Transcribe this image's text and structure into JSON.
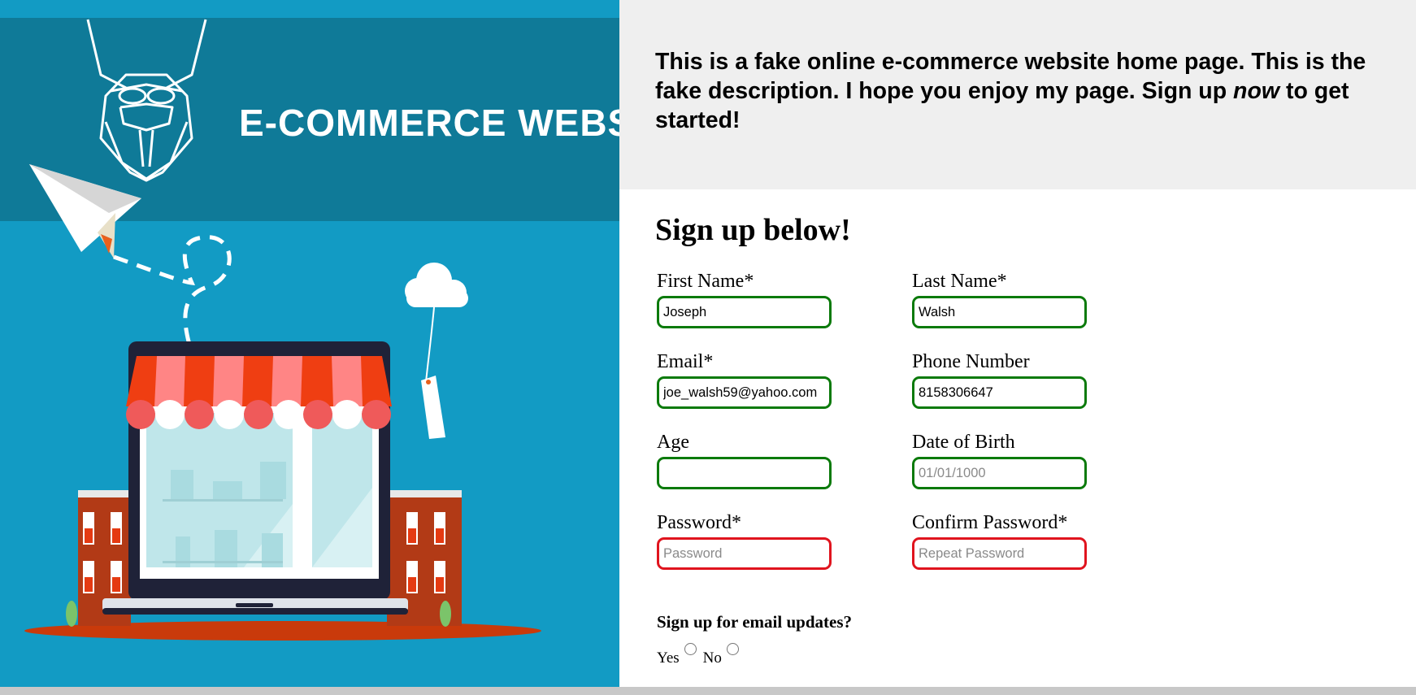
{
  "hero": {
    "site_title": "E-COMMERCE WEBSITE"
  },
  "description": {
    "part1": "This is a fake online e-commerce website home page. This is the fake description. I hope you enjoy my page. Sign up ",
    "emphasis": "now",
    "part2": " to get started!"
  },
  "form": {
    "heading": "Sign up below!",
    "fields": {
      "first_name": {
        "label": "First Name*",
        "value": "Joseph",
        "placeholder": "",
        "valid": true
      },
      "last_name": {
        "label": "Last Name*",
        "value": "Walsh",
        "placeholder": "",
        "valid": true
      },
      "email": {
        "label": "Email*",
        "value": "joe_walsh59@yahoo.com",
        "placeholder": "",
        "valid": true
      },
      "phone": {
        "label": "Phone Number",
        "value": "8158306647",
        "placeholder": "",
        "valid": true
      },
      "age": {
        "label": "Age",
        "value": "",
        "placeholder": "",
        "valid": true
      },
      "dob": {
        "label": "Date of Birth",
        "value": "",
        "placeholder": "01/01/1000",
        "valid": true
      },
      "password": {
        "label": "Password*",
        "value": "",
        "placeholder": "Password",
        "valid": false
      },
      "confirm_password": {
        "label": "Confirm Password*",
        "value": "",
        "placeholder": "Repeat Password",
        "valid": false
      }
    },
    "updates": {
      "question": "Sign up for email updates?",
      "options": [
        "Yes",
        "No"
      ]
    }
  },
  "colors": {
    "hero_bg": "#129bc4",
    "hero_band": "#0f7a98",
    "valid_border": "#0b7a0b",
    "invalid_border": "#e0141e",
    "description_bg": "#efefef"
  }
}
